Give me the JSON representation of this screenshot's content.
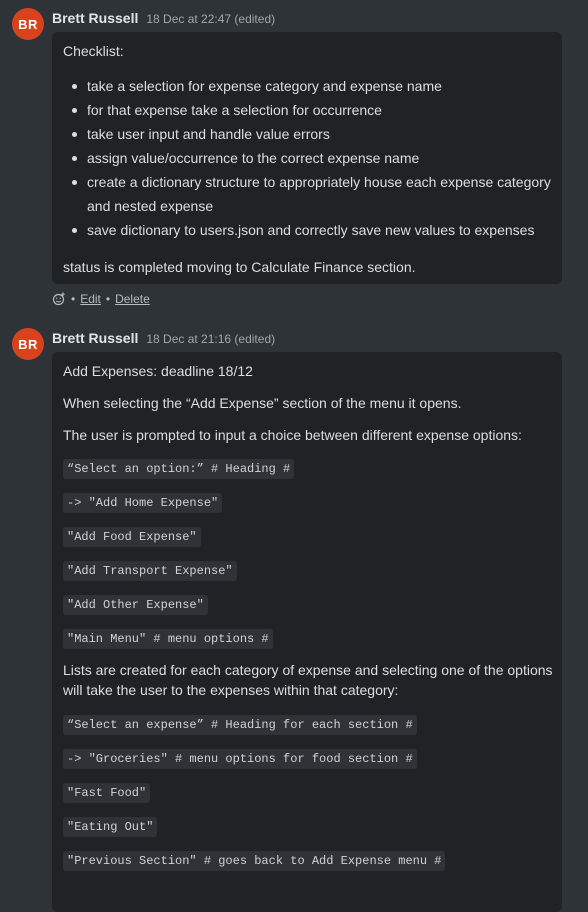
{
  "messages": [
    {
      "avatar_initials": "BR",
      "author": "Brett Russell",
      "timestamp": "18 Dec at 22:47 (edited)",
      "title": "Checklist:",
      "items": [
        "take a selection for expense category and expense name",
        "for that expense take a selection for occurrence",
        "take user input and handle value errors",
        "assign value/occurrence to the correct expense name",
        "create a dictionary structure to appropriately house each expense category and nested expense",
        "save dictionary to users.json and correctly save new values to expenses"
      ],
      "status": "status is completed moving to Calculate Finance section.",
      "actions": {
        "edit": "Edit",
        "separator": "•",
        "delete": "Delete"
      }
    },
    {
      "avatar_initials": "BR",
      "author": "Brett Russell",
      "timestamp": "18 Dec at 21:16 (edited)",
      "title": "Add Expenses: deadline 18/12",
      "para1": "When selecting the “Add Expense” section of the menu it opens.",
      "para2": "The user is prompted to input a choice between different expense options:",
      "code_block1": [
        "“Select an option:” # Heading #",
        "-> \"Add Home Expense\"",
        "\"Add Food Expense\"",
        "\"Add Transport Expense\"",
        "\"Add Other Expense\"",
        "\"Main Menu\" # menu options #"
      ],
      "para3": "Lists are created for each category of expense and selecting one of the options will take the user to the expenses within that category:",
      "code_block2": [
        "“Select an expense” # Heading for each section #",
        "-> \"Groceries\" # menu options for food section #",
        "\"Fast Food\"",
        "\"Eating Out\"",
        "\"Previous Section\" # goes back to Add Expense menu #"
      ]
    }
  ]
}
